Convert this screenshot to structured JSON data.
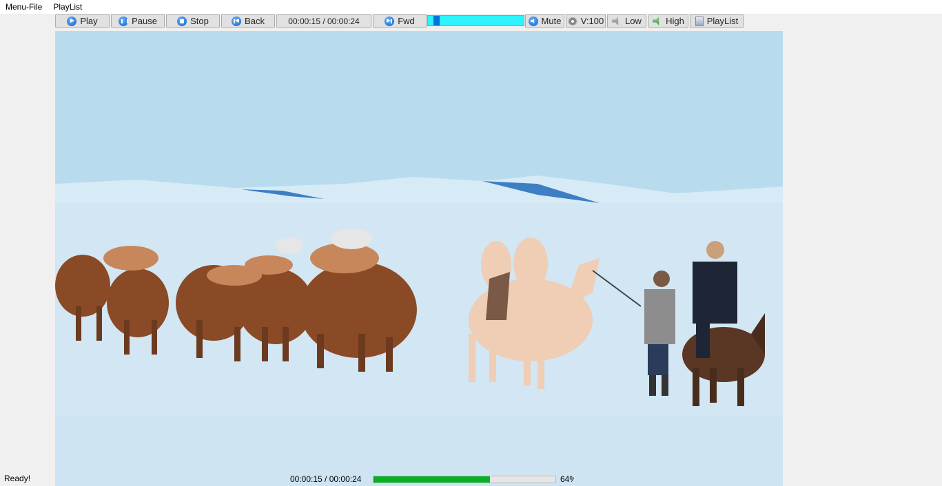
{
  "menu": {
    "items": [
      "Menu-File",
      "PlayList"
    ]
  },
  "toolbar": {
    "play": {
      "label": "Play",
      "icon": "play-icon"
    },
    "pause": {
      "label": "Pause",
      "icon": "pause-icon"
    },
    "stop": {
      "label": "Stop",
      "icon": "stop-icon"
    },
    "back": {
      "label": "Back",
      "icon": "back-icon"
    },
    "time": "00:00:15 / 00:00:24",
    "fwd": {
      "label": "Fwd",
      "icon": "forward-icon"
    },
    "seek_fraction": 0.06,
    "mute": {
      "label": "Mute",
      "icon": "mute-icon"
    },
    "volume": {
      "label": "V:100",
      "icon": "volume-icon"
    },
    "low": {
      "label": "Low",
      "icon": "speaker-low-icon"
    },
    "high": {
      "label": "High",
      "icon": "speaker-high-icon"
    },
    "playlist": {
      "label": "PlayList",
      "icon": "playlist-icon"
    }
  },
  "status": {
    "text": "Ready!",
    "time": "00:00:15 / 00:00:24",
    "progress_percent": 64,
    "percent_label": "64%"
  },
  "colors": {
    "progress": "#06b025",
    "seek_track": "#2cf3ff",
    "seek_thumb": "#0a6fd8",
    "sky": "#b8dcee",
    "snow": "#d2e6f3"
  }
}
